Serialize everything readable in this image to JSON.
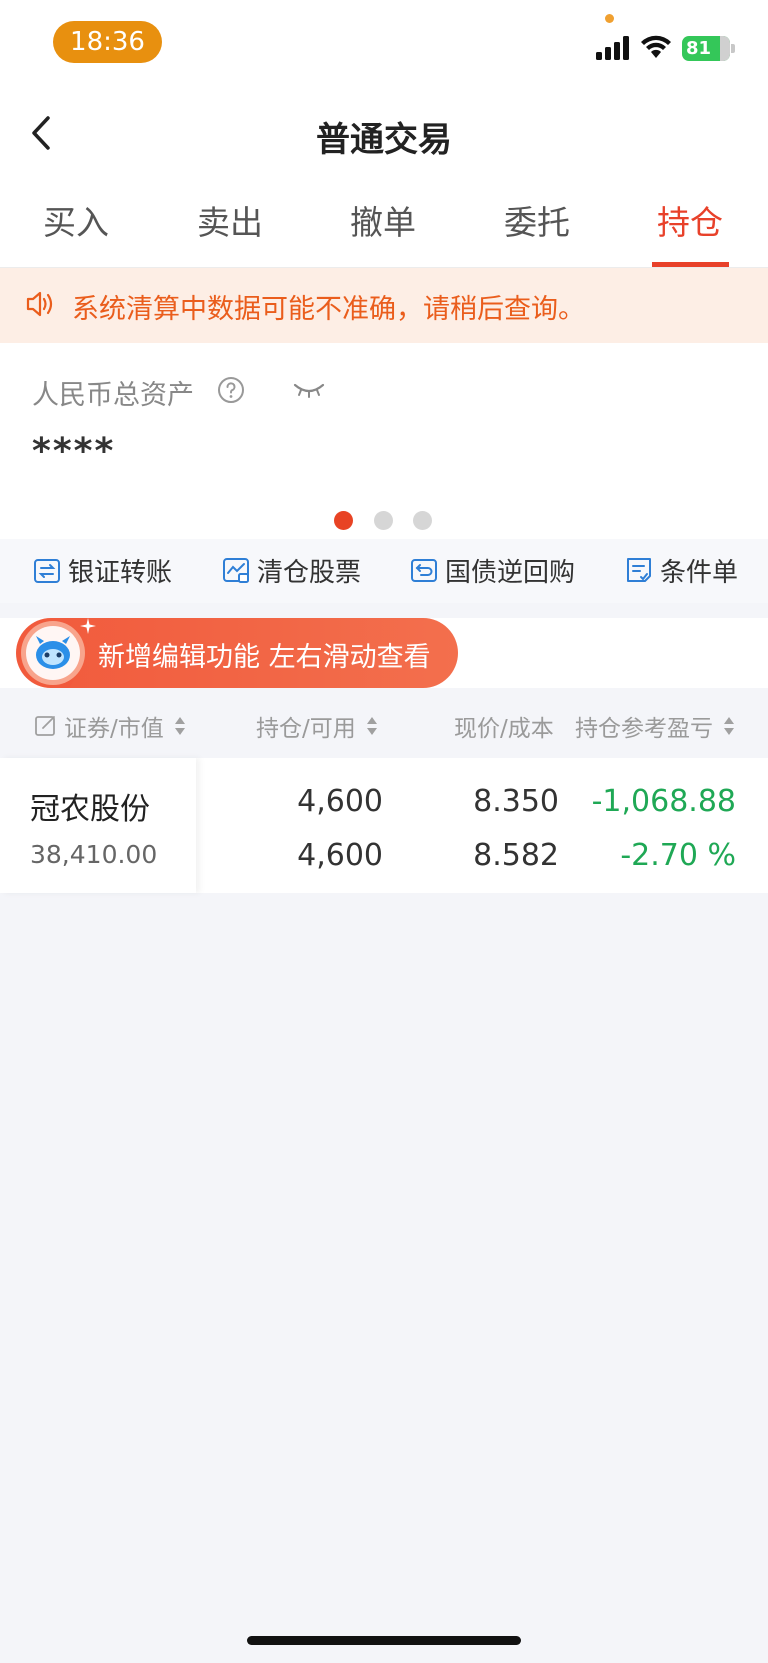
{
  "status_bar": {
    "time": "18:36",
    "battery": "81"
  },
  "header": {
    "title": "普通交易"
  },
  "tabs": [
    {
      "label": "买入"
    },
    {
      "label": "卖出"
    },
    {
      "label": "撤单"
    },
    {
      "label": "委托"
    },
    {
      "label": "持仓"
    }
  ],
  "active_tab": "持仓",
  "notice": {
    "text": "系统清算中数据可能不准确，请稍后查询。"
  },
  "assets": {
    "label": "人民币总资产",
    "value": "****",
    "carousel_page": 1,
    "carousel_total": 3
  },
  "shortcuts": [
    {
      "label": "银证转账",
      "icon": "transfer-icon"
    },
    {
      "label": "清仓股票",
      "icon": "clear-stock-icon"
    },
    {
      "label": "国债逆回购",
      "icon": "repo-icon"
    },
    {
      "label": "条件单",
      "icon": "condition-order-icon"
    }
  ],
  "promo": {
    "text": "新增编辑功能 左右滑动查看"
  },
  "table": {
    "headers": {
      "security": "证券/市值",
      "position": "持仓/可用",
      "price": "现价/成本",
      "pnl": "持仓参考盈亏"
    },
    "rows": [
      {
        "name": "冠农股份",
        "market_value": "38,410.00",
        "position": "4,600",
        "available": "4,600",
        "price": "8.350",
        "cost": "8.582",
        "pnl": "-1,068.88",
        "pnl_pct": "-2.70 %"
      }
    ]
  },
  "colors": {
    "accent": "#e8412a",
    "loss": "#1fa855",
    "notice_bg": "#fdeee5",
    "time_pill": "#e8900f"
  }
}
